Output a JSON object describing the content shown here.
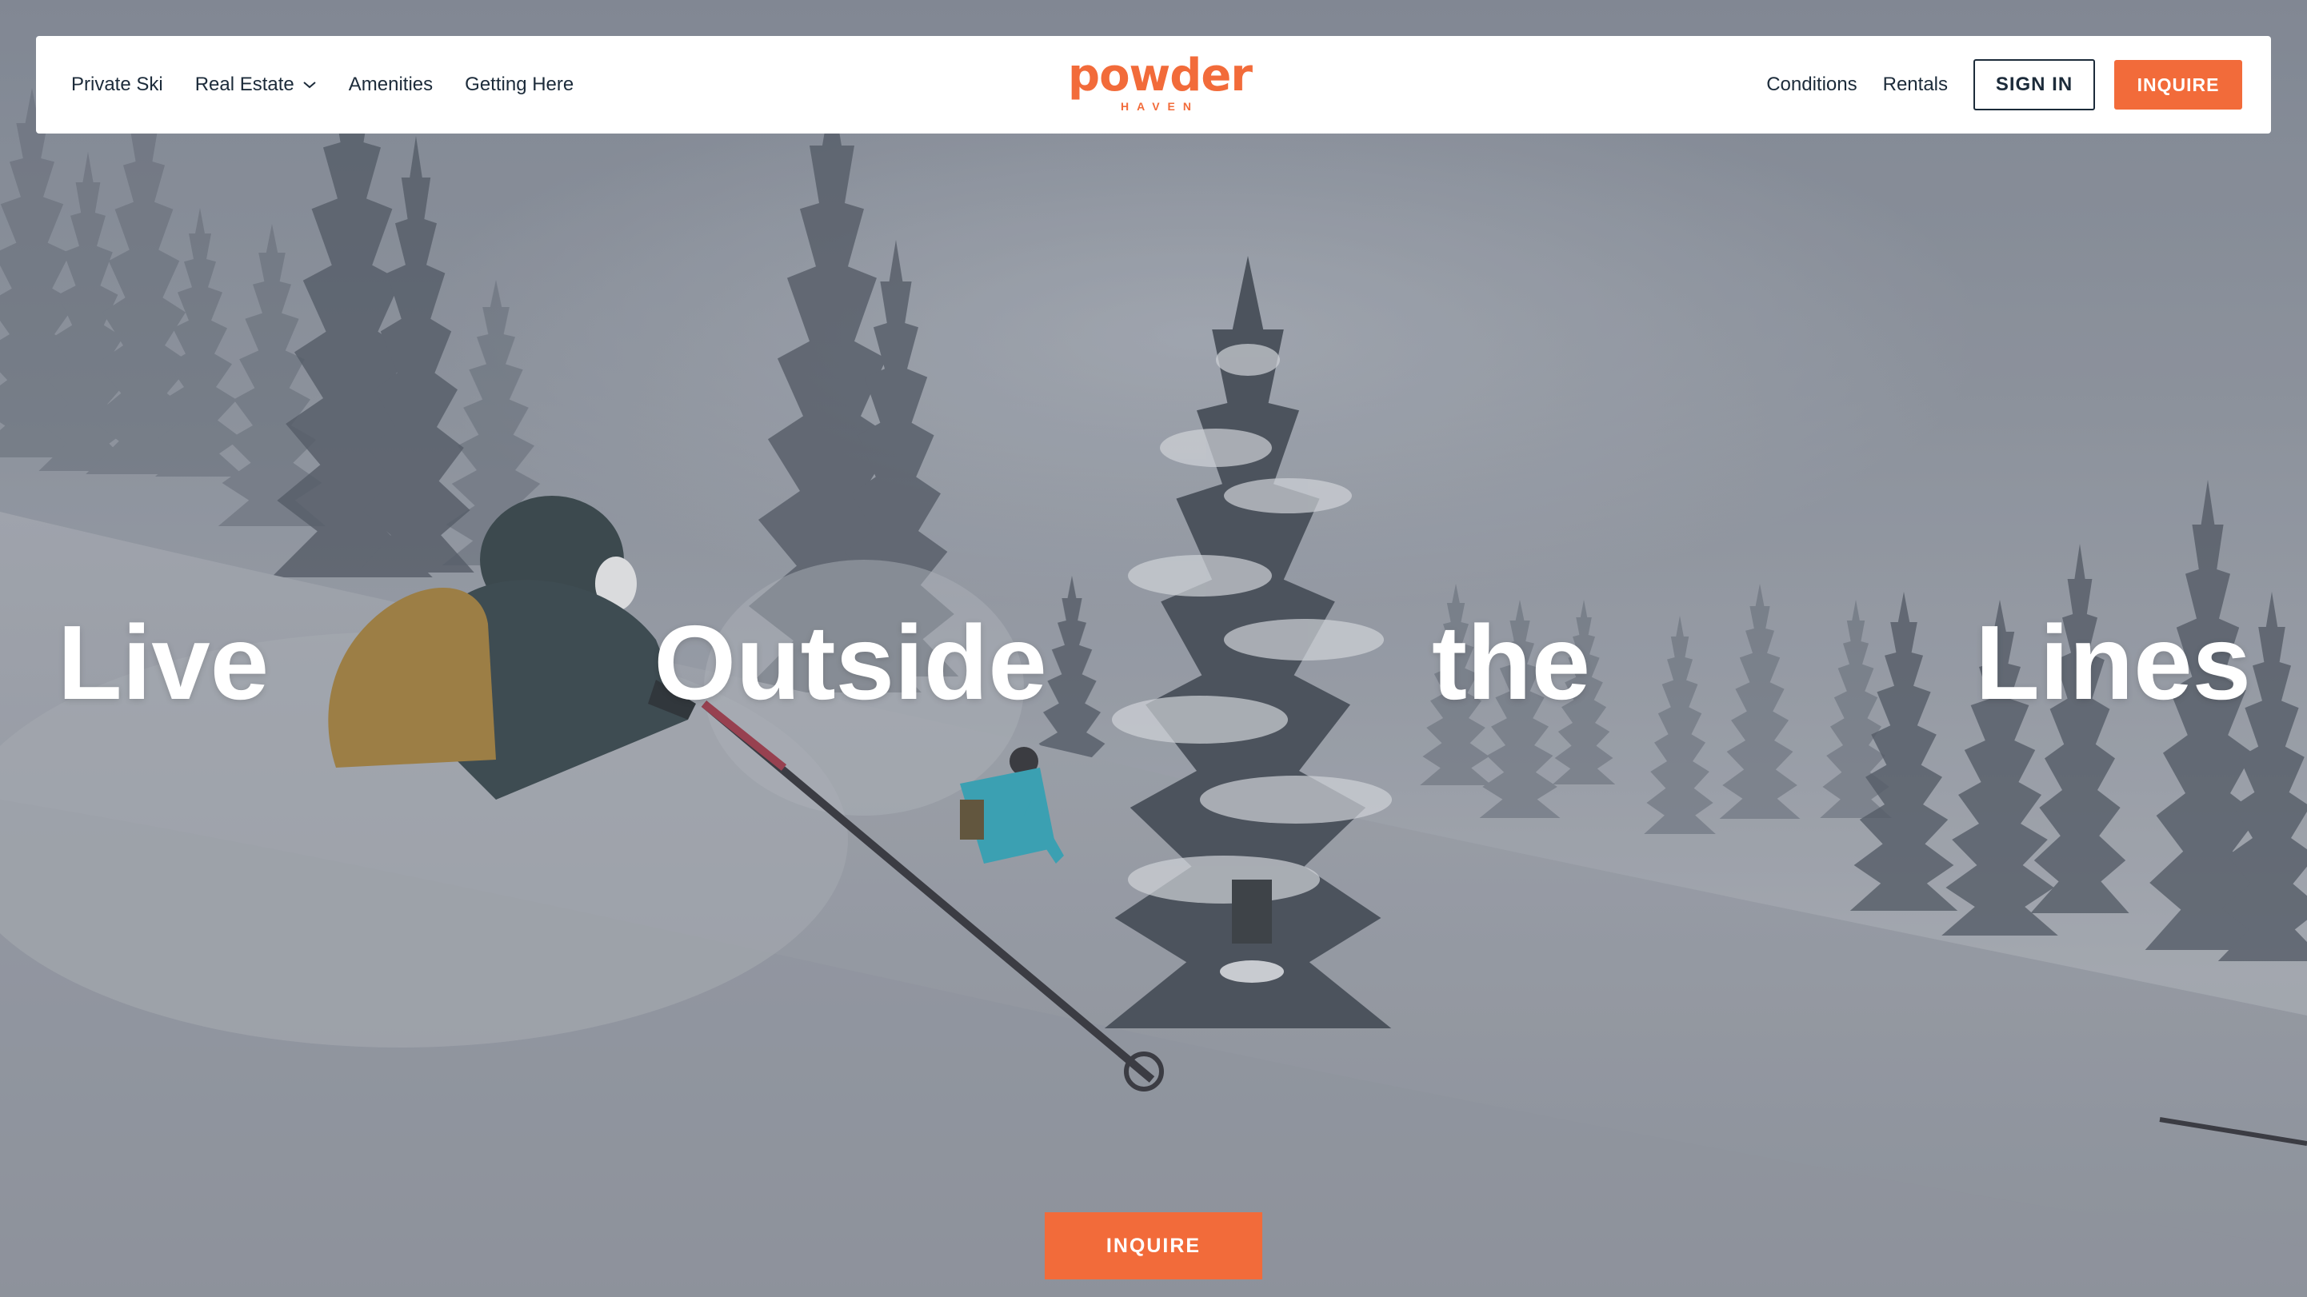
{
  "nav": {
    "left": [
      {
        "label": "Private Ski"
      },
      {
        "label": "Real Estate",
        "has_dropdown": true
      },
      {
        "label": "Amenities"
      },
      {
        "label": "Getting Here"
      }
    ],
    "logo": {
      "main": "powder",
      "sub": "HAVEN"
    },
    "right": [
      {
        "label": "Conditions"
      },
      {
        "label": "Rentals"
      }
    ],
    "signin_label": "SIGN IN",
    "inquire_label": "INQUIRE"
  },
  "hero": {
    "headline_words": [
      "Live",
      "Outside",
      "the",
      "Lines"
    ],
    "cta_label": "INQUIRE",
    "image_description_icon": "skiers-in-powder-forest"
  },
  "colors": {
    "accent": "#f26b3a",
    "text_dark": "#1c2b3a",
    "white": "#ffffff"
  }
}
